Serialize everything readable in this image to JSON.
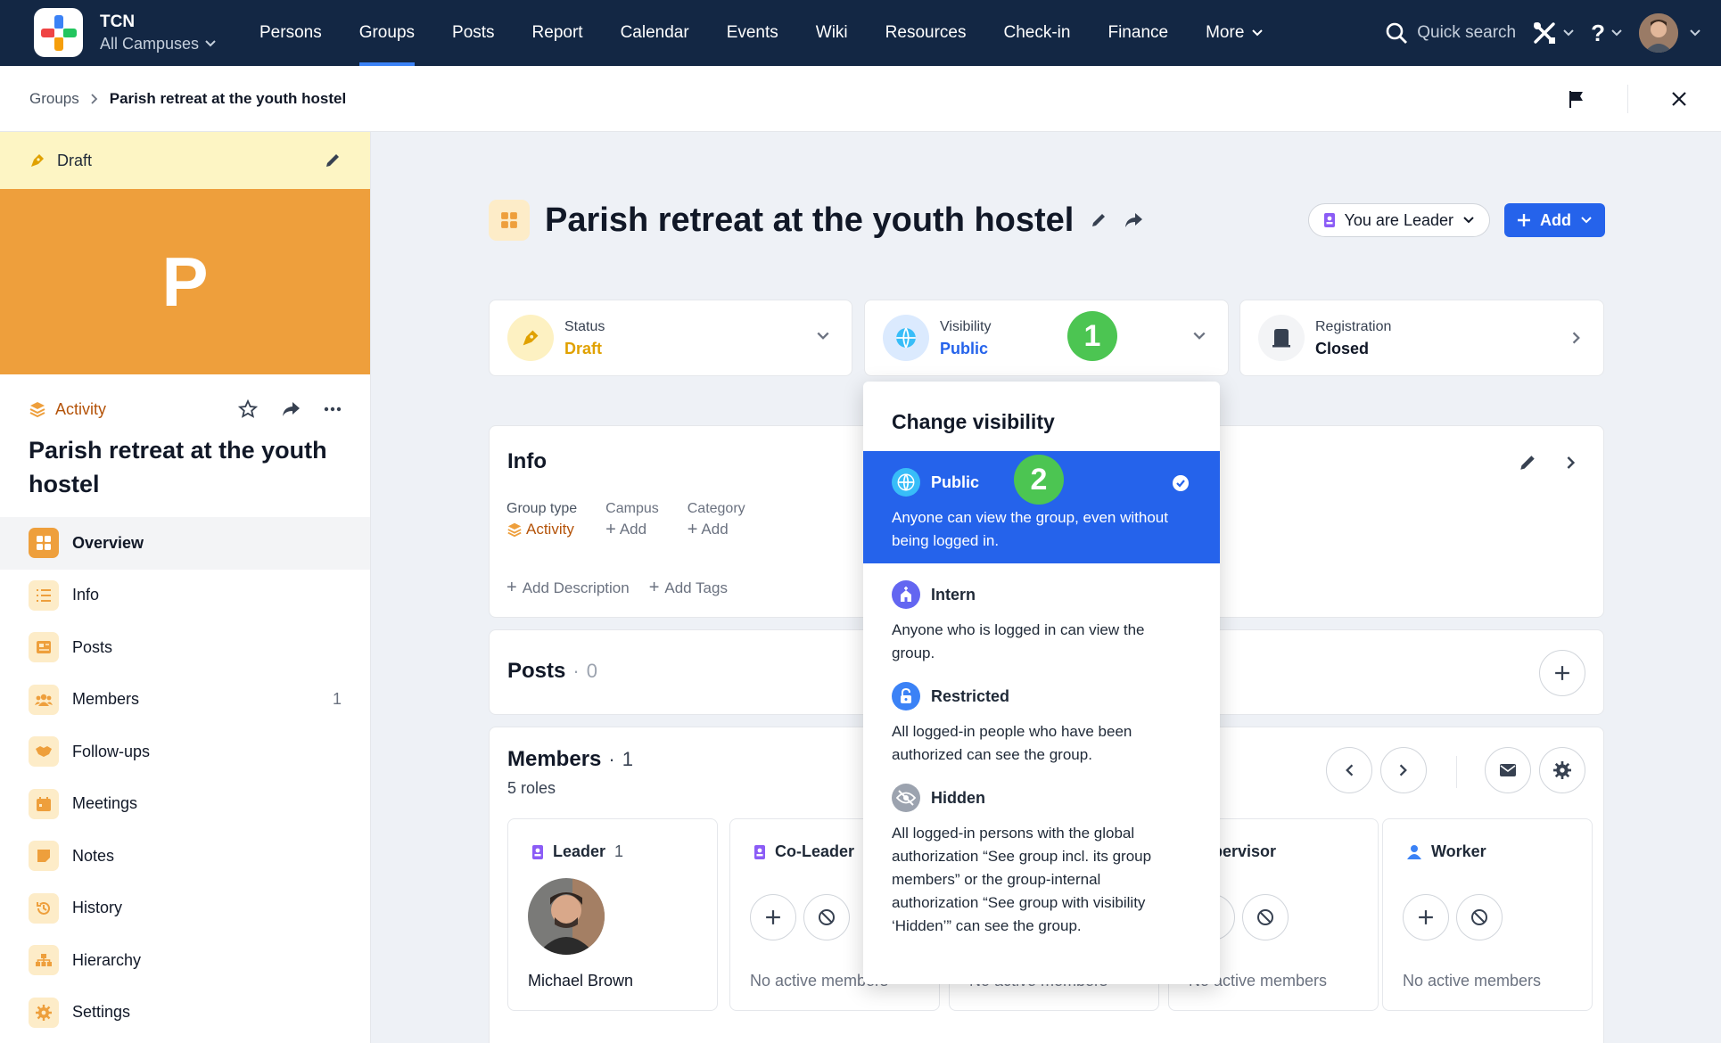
{
  "topnav": {
    "org_name": "TCN",
    "campus": "All Campuses",
    "items": [
      {
        "label": "Persons"
      },
      {
        "label": "Groups"
      },
      {
        "label": "Posts"
      },
      {
        "label": "Report"
      },
      {
        "label": "Calendar"
      },
      {
        "label": "Events"
      },
      {
        "label": "Wiki"
      },
      {
        "label": "Resources"
      },
      {
        "label": "Check-in"
      },
      {
        "label": "Finance"
      },
      {
        "label": "More"
      }
    ],
    "active": "Groups",
    "search_label": "Quick search",
    "help": "?"
  },
  "breadcrumb": {
    "parent": "Groups",
    "current": "Parish retreat at the youth hostel"
  },
  "sidebar": {
    "draft_label": "Draft",
    "hero_letter": "P",
    "type_label": "Activity",
    "title": "Parish retreat at the youth hostel",
    "menu": [
      {
        "label": "Overview"
      },
      {
        "label": "Info"
      },
      {
        "label": "Posts"
      },
      {
        "label": "Members",
        "count": "1"
      },
      {
        "label": "Follow-ups"
      },
      {
        "label": "Meetings"
      },
      {
        "label": "Notes"
      },
      {
        "label": "History"
      },
      {
        "label": "Hierarchy"
      },
      {
        "label": "Settings"
      }
    ]
  },
  "header": {
    "title": "Parish retreat at the youth hostel",
    "leader_label": "You are Leader",
    "add_label": "Add"
  },
  "status_cards": {
    "status": {
      "label": "Status",
      "value": "Draft",
      "color": "#e0a100"
    },
    "visibility": {
      "label": "Visibility",
      "value": "Public",
      "color": "#2563eb"
    },
    "registration": {
      "label": "Registration",
      "value": "Closed"
    }
  },
  "badges": {
    "one": "1",
    "two": "2"
  },
  "info": {
    "title": "Info",
    "group_type_label": "Group type",
    "group_type_value": "Activity",
    "campus_label": "Campus",
    "campus_value": "Add",
    "category_label": "Category",
    "category_value": "Add",
    "add_description": "Add Description",
    "add_tags": "Add Tags"
  },
  "posts": {
    "title": "Posts",
    "count": "0"
  },
  "members": {
    "title": "Members",
    "count": "1",
    "roles": "5 roles",
    "role_cards": [
      {
        "name": "Leader",
        "count": "1",
        "member": "Michael Brown"
      },
      {
        "name": "Co-Leader",
        "empty": "No active members"
      },
      {
        "name": "",
        "empty": "No active members"
      },
      {
        "name": "Supervisor",
        "empty": "No active members"
      },
      {
        "name": "Worker",
        "empty": "No active members"
      }
    ]
  },
  "visibility_dropdown": {
    "title": "Change visibility",
    "options": [
      {
        "name": "Public",
        "desc": "Anyone can view the group, even without being logged in.",
        "selected": true
      },
      {
        "name": "Intern",
        "desc": "Anyone who is logged in can view the group."
      },
      {
        "name": "Restricted",
        "desc": "All logged-in people who have been authorized can see the group."
      },
      {
        "name": "Hidden",
        "desc": "All logged-in persons with the global authorization “See group incl. its group members” or the group-internal authorization “See group with visibility ‘Hidden’” can see the group."
      }
    ]
  },
  "colors": {
    "nav_bg": "#132744",
    "accent": "#2563eb",
    "orange": "#ee9f3c",
    "badge_green": "#4cc552"
  }
}
